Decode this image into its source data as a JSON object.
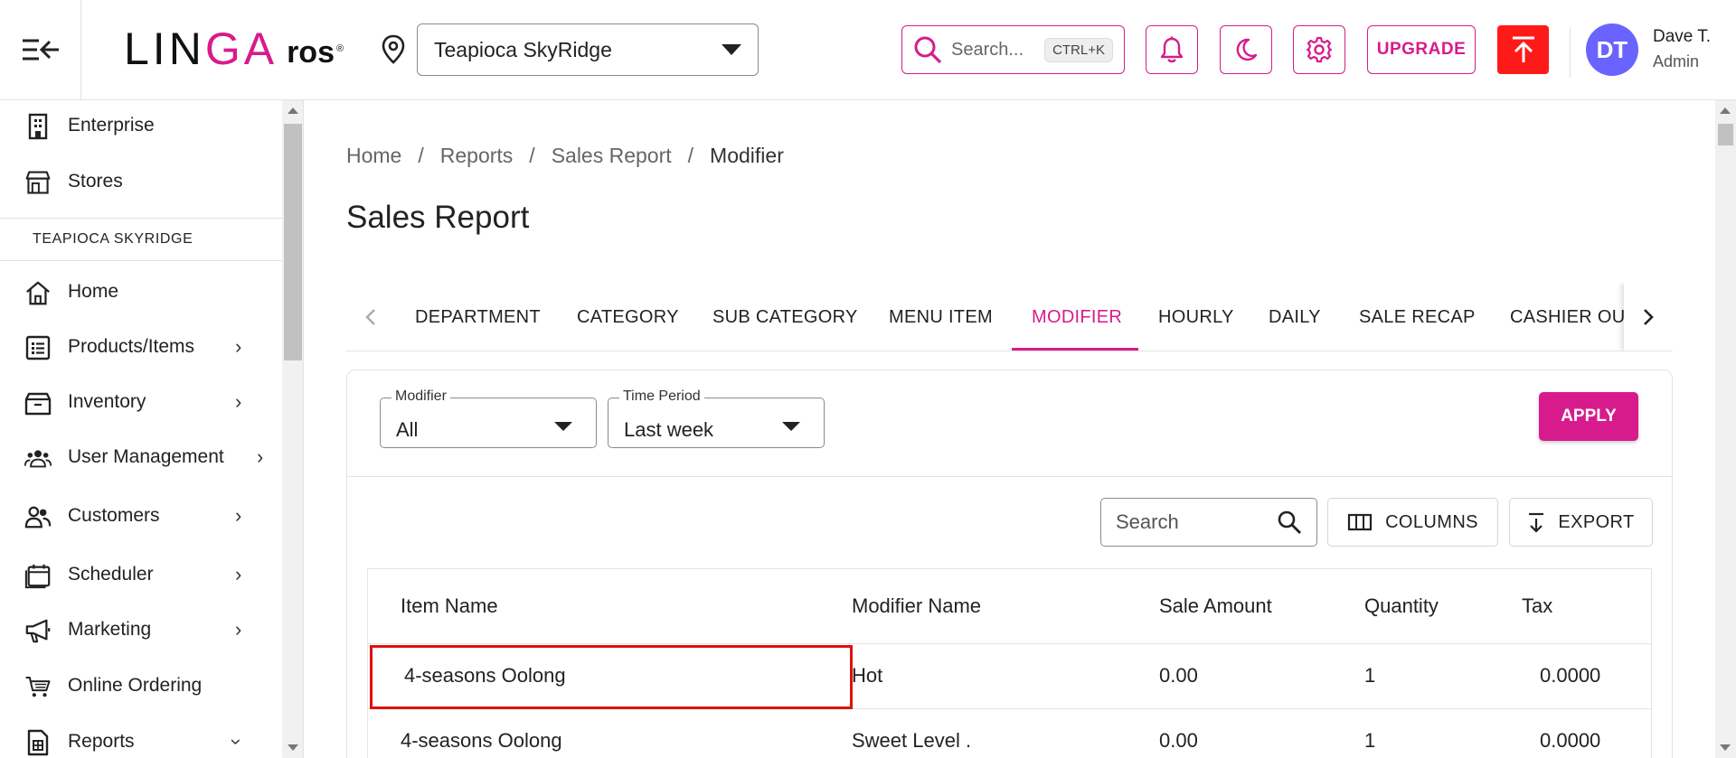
{
  "header": {
    "logo": {
      "text_main": "LIN",
      "text_accent": "GA",
      "text_suffix": "ros",
      "registered": "®"
    },
    "store_selector": {
      "value": "Teapioca SkyRidge"
    },
    "search": {
      "placeholder": "Search...",
      "shortcut": "CTRL+K"
    },
    "upgrade_label": "UPGRADE",
    "user": {
      "initials": "DT",
      "name": "Dave T.",
      "role": "Admin"
    },
    "accent_color": "#d81b8c"
  },
  "sidebar": {
    "top_items": [
      {
        "label": "Enterprise",
        "icon": "building-icon"
      },
      {
        "label": "Stores",
        "icon": "store-icon"
      }
    ],
    "section_title": "TEAPIOCA SKYRIDGE",
    "items": [
      {
        "label": "Home",
        "icon": "home-icon"
      },
      {
        "label": "Products/Items",
        "icon": "list-icon"
      },
      {
        "label": "Inventory",
        "icon": "box-icon"
      },
      {
        "label": "User Management",
        "icon": "users-icon"
      },
      {
        "label": "Customers",
        "icon": "customers-icon"
      },
      {
        "label": "Scheduler",
        "icon": "calendar-icon"
      },
      {
        "label": "Marketing",
        "icon": "megaphone-icon"
      },
      {
        "label": "Online Ordering",
        "icon": "cart-icon"
      },
      {
        "label": "Reports",
        "icon": "report-icon"
      }
    ]
  },
  "breadcrumb": [
    "Home",
    "Reports",
    "Sales Report",
    "Modifier"
  ],
  "page_title": "Sales Report",
  "tabs": [
    "DEPARTMENT",
    "CATEGORY",
    "SUB CATEGORY",
    "MENU ITEM",
    "MODIFIER",
    "HOURLY",
    "DAILY",
    "SALE RECAP",
    "CASHIER OUT"
  ],
  "active_tab": "MODIFIER",
  "filters": {
    "modifier": {
      "label": "Modifier",
      "value": "All"
    },
    "time_period": {
      "label": "Time Period",
      "value": "Last week"
    },
    "apply_label": "APPLY"
  },
  "table_toolbar": {
    "search_placeholder": "Search",
    "columns_label": "COLUMNS",
    "export_label": "EXPORT"
  },
  "table": {
    "columns": [
      "Item Name",
      "Modifier Name",
      "Sale Amount",
      "Quantity",
      "Tax"
    ],
    "rows": [
      [
        "4-seasons Oolong",
        "Hot",
        "0.00",
        "1",
        "0.0000"
      ],
      [
        "4-seasons Oolong",
        "Sweet Level .",
        "0.00",
        "1",
        "0.0000"
      ]
    ]
  }
}
